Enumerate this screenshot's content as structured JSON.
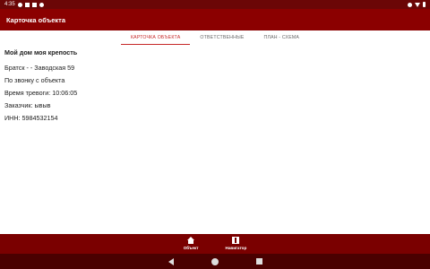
{
  "status_bar": {
    "time": "4:35"
  },
  "app_bar": {
    "title": "Карточка объекта"
  },
  "tabs": [
    {
      "label": "КАРТОЧКА ОБЪЕКТА",
      "active": true
    },
    {
      "label": "ОТВЕТСТВЕННЫЕ",
      "active": false
    },
    {
      "label": "ПЛАН - СХЕМА",
      "active": false
    }
  ],
  "content": {
    "title": "Мой дом моя крепость",
    "address": "Братск -  - Заводская 59",
    "source": "По звонку с объекта",
    "alarm_time": "Время тревоги: 10:06:05",
    "customer": "Заказчик: ывыв",
    "inn": "ИНН: 5984532154"
  },
  "bottom_nav": [
    {
      "label": "Объект",
      "icon": "home-icon"
    },
    {
      "label": "Навигатор",
      "icon": "map-icon"
    }
  ],
  "colors": {
    "status_bar": "#6b0606",
    "app_bar": "#8b0000",
    "accent": "#c62828",
    "bottom_nav": "#7a0000",
    "system_nav": "#4a0000"
  }
}
